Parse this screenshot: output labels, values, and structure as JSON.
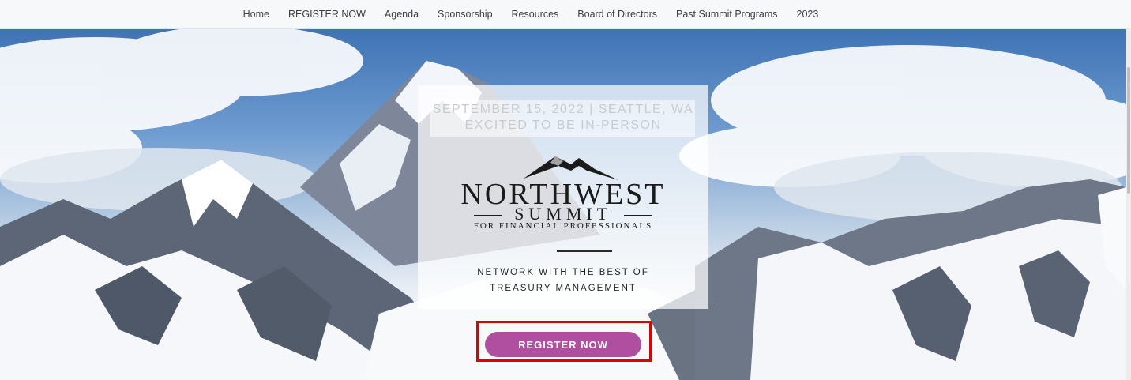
{
  "nav": {
    "items": [
      "Home",
      "REGISTER NOW",
      "Agenda",
      "Sponsorship",
      "Resources",
      "Board of Directors",
      "Past Summit Programs",
      "2023"
    ]
  },
  "hero": {
    "date_line1": "SEPTEMBER 15, 2022 | SEATTLE, WA",
    "date_line2": "EXCITED TO BE IN-PERSON",
    "logo_title": "NORTHWEST",
    "logo_subtitle": "SUMMIT",
    "logo_tagline": "FOR FINANCIAL PROFESSIONALS",
    "tag_line1": "NETWORK WITH THE BEST OF",
    "tag_line2": "TREASURY MANAGEMENT",
    "register_label": "REGISTER NOW"
  },
  "colors": {
    "accent": "#b04f9f",
    "highlight": "#e00000"
  },
  "icons": {
    "logo_mark": "mountain-peak-icon"
  }
}
